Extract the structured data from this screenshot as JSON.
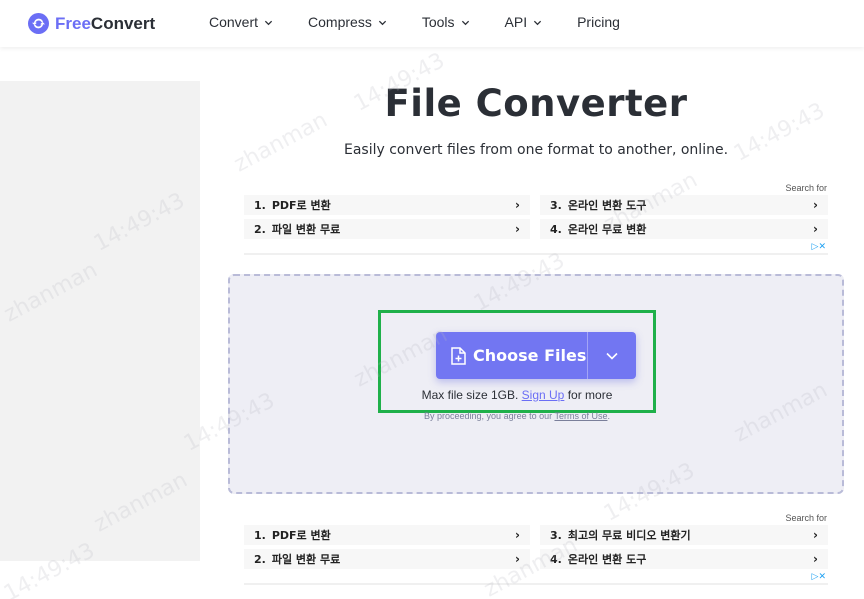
{
  "header": {
    "logo_free": "Free",
    "logo_convert": "Convert",
    "nav": [
      {
        "label": "Convert"
      },
      {
        "label": "Compress"
      },
      {
        "label": "Tools"
      },
      {
        "label": "API"
      },
      {
        "label": "Pricing"
      }
    ]
  },
  "hero": {
    "title": "File Converter",
    "subtitle": "Easily convert files from one format to another, online."
  },
  "ad_top": {
    "search_for": "Search for",
    "items": [
      {
        "num": "1.",
        "label": "PDF로 변환"
      },
      {
        "num": "2.",
        "label": "파일 변환 무료"
      },
      {
        "num": "3.",
        "label": "온라인 변환 도구"
      },
      {
        "num": "4.",
        "label": "온라인 무료 변환"
      }
    ]
  },
  "upload": {
    "choose_label": "Choose Files",
    "max_prefix": "Max file size 1GB.",
    "signup": "Sign Up",
    "max_suffix": "for more",
    "terms_prefix": "By proceeding, you agree to our",
    "terms_link": "Terms of Use",
    "terms_suffix": "."
  },
  "ad_bottom": {
    "search_for": "Search for",
    "items": [
      {
        "num": "1.",
        "label": "PDF로 변환"
      },
      {
        "num": "2.",
        "label": "파일 변환 무료"
      },
      {
        "num": "3.",
        "label": "최고의 무료 비디오 변환기"
      },
      {
        "num": "4.",
        "label": "온라인 변환 도구"
      }
    ]
  },
  "watermark": {
    "name": "zhanman",
    "time": "14:49:43"
  },
  "colors": {
    "accent": "#7276f2",
    "highlight": "#1fb04a"
  }
}
